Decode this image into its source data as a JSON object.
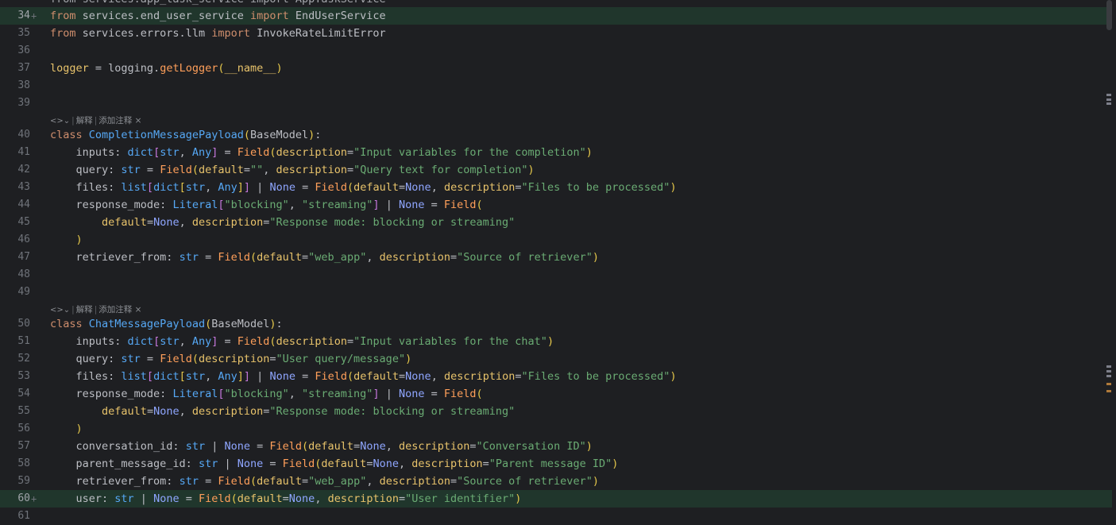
{
  "colors": {
    "background": "#1e1f22",
    "added_line": "#20362c",
    "keyword": "#cf8e6d",
    "string": "#6aab73",
    "function": "#56a8f5",
    "none": "#8fa6ff"
  },
  "top_partial": "from services.app_task_service import AppTaskService",
  "lens_labels": {
    "explain": "解释",
    "add_comment": "添加注释",
    "close": "×",
    "icon": "<>⌄"
  },
  "lines": [
    {
      "n": "34",
      "added": true,
      "tokens": [
        [
          "kw",
          "from"
        ],
        [
          "p",
          " services.end_user_service "
        ],
        [
          "kw",
          "import"
        ],
        [
          "p",
          " EndUserService"
        ]
      ]
    },
    {
      "n": "35",
      "tokens": [
        [
          "kw",
          "from"
        ],
        [
          "p",
          " services.errors.llm "
        ],
        [
          "kw",
          "import"
        ],
        [
          "p",
          " InvokeRateLimitError"
        ]
      ]
    },
    {
      "n": "36",
      "tokens": []
    },
    {
      "n": "37",
      "tokens": [
        [
          "field",
          "logger"
        ],
        [
          "p",
          " = logging."
        ],
        [
          "call",
          "getLogger"
        ],
        [
          "paren",
          "("
        ],
        [
          "field",
          "__name__"
        ],
        [
          "paren",
          ")"
        ]
      ]
    },
    {
      "n": "38",
      "tokens": []
    },
    {
      "n": "39",
      "tokens": []
    },
    {
      "lens": true
    },
    {
      "n": "40",
      "tokens": [
        [
          "kw",
          "class"
        ],
        [
          "p",
          " "
        ],
        [
          "cls",
          "CompletionMessagePayload"
        ],
        [
          "paren",
          "("
        ],
        [
          "p",
          "BaseModel"
        ],
        [
          "paren",
          ")"
        ],
        [
          "p",
          ":"
        ]
      ]
    },
    {
      "n": "41",
      "tokens": [
        [
          "p",
          "    inputs: "
        ],
        [
          "type",
          "dict"
        ],
        [
          "brk",
          "["
        ],
        [
          "type",
          "str"
        ],
        [
          "p",
          ", "
        ],
        [
          "type",
          "Any"
        ],
        [
          "brk",
          "]"
        ],
        [
          "p",
          " = "
        ],
        [
          "call",
          "Field"
        ],
        [
          "paren",
          "("
        ],
        [
          "kwarg",
          "description"
        ],
        [
          "p",
          "="
        ],
        [
          "str",
          "\"Input variables for the completion\""
        ],
        [
          "paren",
          ")"
        ]
      ]
    },
    {
      "n": "42",
      "tokens": [
        [
          "p",
          "    query: "
        ],
        [
          "type",
          "str"
        ],
        [
          "p",
          " = "
        ],
        [
          "call",
          "Field"
        ],
        [
          "paren",
          "("
        ],
        [
          "kwarg",
          "default"
        ],
        [
          "p",
          "="
        ],
        [
          "str",
          "\"\""
        ],
        [
          "p",
          ", "
        ],
        [
          "kwarg",
          "description"
        ],
        [
          "p",
          "="
        ],
        [
          "str",
          "\"Query text for completion\""
        ],
        [
          "paren",
          ")"
        ]
      ]
    },
    {
      "n": "43",
      "tokens": [
        [
          "p",
          "    files: "
        ],
        [
          "type",
          "list"
        ],
        [
          "brk",
          "["
        ],
        [
          "type",
          "dict"
        ],
        [
          "paren",
          "["
        ],
        [
          "type",
          "str"
        ],
        [
          "p",
          ", "
        ],
        [
          "type",
          "Any"
        ],
        [
          "paren",
          "]"
        ],
        [
          "brk",
          "]"
        ],
        [
          "p",
          " | "
        ],
        [
          "none",
          "None"
        ],
        [
          "p",
          " = "
        ],
        [
          "call",
          "Field"
        ],
        [
          "paren",
          "("
        ],
        [
          "kwarg",
          "default"
        ],
        [
          "p",
          "="
        ],
        [
          "none",
          "None"
        ],
        [
          "p",
          ", "
        ],
        [
          "kwarg",
          "description"
        ],
        [
          "p",
          "="
        ],
        [
          "str",
          "\"Files to be processed\""
        ],
        [
          "paren",
          ")"
        ]
      ]
    },
    {
      "n": "44",
      "tokens": [
        [
          "p",
          "    response_mode: "
        ],
        [
          "type",
          "Literal"
        ],
        [
          "brk",
          "["
        ],
        [
          "str",
          "\"blocking\""
        ],
        [
          "p",
          ", "
        ],
        [
          "str",
          "\"streaming\""
        ],
        [
          "brk",
          "]"
        ],
        [
          "p",
          " | "
        ],
        [
          "none",
          "None"
        ],
        [
          "p",
          " = "
        ],
        [
          "call",
          "Field"
        ],
        [
          "paren",
          "("
        ]
      ]
    },
    {
      "n": "45",
      "tokens": [
        [
          "p",
          "        "
        ],
        [
          "kwarg",
          "default"
        ],
        [
          "p",
          "="
        ],
        [
          "none",
          "None"
        ],
        [
          "p",
          ", "
        ],
        [
          "kwarg",
          "description"
        ],
        [
          "p",
          "="
        ],
        [
          "str",
          "\"Response mode: blocking or streaming\""
        ]
      ]
    },
    {
      "n": "46",
      "tokens": [
        [
          "p",
          "    "
        ],
        [
          "paren",
          ")"
        ]
      ]
    },
    {
      "n": "47",
      "tokens": [
        [
          "p",
          "    retriever_from: "
        ],
        [
          "type",
          "str"
        ],
        [
          "p",
          " = "
        ],
        [
          "call",
          "Field"
        ],
        [
          "paren",
          "("
        ],
        [
          "kwarg",
          "default"
        ],
        [
          "p",
          "="
        ],
        [
          "str",
          "\"web_app\""
        ],
        [
          "p",
          ", "
        ],
        [
          "kwarg",
          "description"
        ],
        [
          "p",
          "="
        ],
        [
          "str",
          "\"Source of retriever\""
        ],
        [
          "paren",
          ")"
        ]
      ]
    },
    {
      "n": "48",
      "tokens": []
    },
    {
      "n": "49",
      "tokens": []
    },
    {
      "lens": true
    },
    {
      "n": "50",
      "tokens": [
        [
          "kw",
          "class"
        ],
        [
          "p",
          " "
        ],
        [
          "cls",
          "ChatMessagePayload"
        ],
        [
          "paren",
          "("
        ],
        [
          "p",
          "BaseModel"
        ],
        [
          "paren",
          ")"
        ],
        [
          "p",
          ":"
        ]
      ]
    },
    {
      "n": "51",
      "tokens": [
        [
          "p",
          "    inputs: "
        ],
        [
          "type",
          "dict"
        ],
        [
          "brk",
          "["
        ],
        [
          "type",
          "str"
        ],
        [
          "p",
          ", "
        ],
        [
          "type",
          "Any"
        ],
        [
          "brk",
          "]"
        ],
        [
          "p",
          " = "
        ],
        [
          "call",
          "Field"
        ],
        [
          "paren",
          "("
        ],
        [
          "kwarg",
          "description"
        ],
        [
          "p",
          "="
        ],
        [
          "str",
          "\"Input variables for the chat\""
        ],
        [
          "paren",
          ")"
        ]
      ]
    },
    {
      "n": "52",
      "tokens": [
        [
          "p",
          "    query: "
        ],
        [
          "type",
          "str"
        ],
        [
          "p",
          " = "
        ],
        [
          "call",
          "Field"
        ],
        [
          "paren",
          "("
        ],
        [
          "kwarg",
          "description"
        ],
        [
          "p",
          "="
        ],
        [
          "str",
          "\"User query/message\""
        ],
        [
          "paren",
          ")"
        ]
      ]
    },
    {
      "n": "53",
      "tokens": [
        [
          "p",
          "    files: "
        ],
        [
          "type",
          "list"
        ],
        [
          "brk",
          "["
        ],
        [
          "type",
          "dict"
        ],
        [
          "paren",
          "["
        ],
        [
          "type",
          "str"
        ],
        [
          "p",
          ", "
        ],
        [
          "type",
          "Any"
        ],
        [
          "paren",
          "]"
        ],
        [
          "brk",
          "]"
        ],
        [
          "p",
          " | "
        ],
        [
          "none",
          "None"
        ],
        [
          "p",
          " = "
        ],
        [
          "call",
          "Field"
        ],
        [
          "paren",
          "("
        ],
        [
          "kwarg",
          "default"
        ],
        [
          "p",
          "="
        ],
        [
          "none",
          "None"
        ],
        [
          "p",
          ", "
        ],
        [
          "kwarg",
          "description"
        ],
        [
          "p",
          "="
        ],
        [
          "str",
          "\"Files to be processed\""
        ],
        [
          "paren",
          ")"
        ]
      ]
    },
    {
      "n": "54",
      "tokens": [
        [
          "p",
          "    response_mode: "
        ],
        [
          "type",
          "Literal"
        ],
        [
          "brk",
          "["
        ],
        [
          "str",
          "\"blocking\""
        ],
        [
          "p",
          ", "
        ],
        [
          "str",
          "\"streaming\""
        ],
        [
          "brk",
          "]"
        ],
        [
          "p",
          " | "
        ],
        [
          "none",
          "None"
        ],
        [
          "p",
          " = "
        ],
        [
          "call",
          "Field"
        ],
        [
          "paren",
          "("
        ]
      ]
    },
    {
      "n": "55",
      "tokens": [
        [
          "p",
          "        "
        ],
        [
          "kwarg",
          "default"
        ],
        [
          "p",
          "="
        ],
        [
          "none",
          "None"
        ],
        [
          "p",
          ", "
        ],
        [
          "kwarg",
          "description"
        ],
        [
          "p",
          "="
        ],
        [
          "str",
          "\"Response mode: blocking or streaming\""
        ]
      ]
    },
    {
      "n": "56",
      "tokens": [
        [
          "p",
          "    "
        ],
        [
          "paren",
          ")"
        ]
      ]
    },
    {
      "n": "57",
      "tokens": [
        [
          "p",
          "    conversation_id: "
        ],
        [
          "type",
          "str"
        ],
        [
          "p",
          " | "
        ],
        [
          "none",
          "None"
        ],
        [
          "p",
          " = "
        ],
        [
          "call",
          "Field"
        ],
        [
          "paren",
          "("
        ],
        [
          "kwarg",
          "default"
        ],
        [
          "p",
          "="
        ],
        [
          "none",
          "None"
        ],
        [
          "p",
          ", "
        ],
        [
          "kwarg",
          "description"
        ],
        [
          "p",
          "="
        ],
        [
          "str",
          "\"Conversation ID\""
        ],
        [
          "paren",
          ")"
        ]
      ]
    },
    {
      "n": "58",
      "tokens": [
        [
          "p",
          "    parent_message_id: "
        ],
        [
          "type",
          "str"
        ],
        [
          "p",
          " | "
        ],
        [
          "none",
          "None"
        ],
        [
          "p",
          " = "
        ],
        [
          "call",
          "Field"
        ],
        [
          "paren",
          "("
        ],
        [
          "kwarg",
          "default"
        ],
        [
          "p",
          "="
        ],
        [
          "none",
          "None"
        ],
        [
          "p",
          ", "
        ],
        [
          "kwarg",
          "description"
        ],
        [
          "p",
          "="
        ],
        [
          "str",
          "\"Parent message ID\""
        ],
        [
          "paren",
          ")"
        ]
      ]
    },
    {
      "n": "59",
      "tokens": [
        [
          "p",
          "    retriever_from: "
        ],
        [
          "type",
          "str"
        ],
        [
          "p",
          " = "
        ],
        [
          "call",
          "Field"
        ],
        [
          "paren",
          "("
        ],
        [
          "kwarg",
          "default"
        ],
        [
          "p",
          "="
        ],
        [
          "str",
          "\"web_app\""
        ],
        [
          "p",
          ", "
        ],
        [
          "kwarg",
          "description"
        ],
        [
          "p",
          "="
        ],
        [
          "str",
          "\"Source of retriever\""
        ],
        [
          "paren",
          ")"
        ]
      ]
    },
    {
      "n": "60",
      "added": true,
      "tokens": [
        [
          "p",
          "    user: "
        ],
        [
          "type",
          "str"
        ],
        [
          "p",
          " | "
        ],
        [
          "none",
          "None"
        ],
        [
          "p",
          " = "
        ],
        [
          "call",
          "Field"
        ],
        [
          "paren",
          "("
        ],
        [
          "kwarg",
          "default"
        ],
        [
          "p",
          "="
        ],
        [
          "none",
          "None"
        ],
        [
          "p",
          ", "
        ],
        [
          "kwarg",
          "description"
        ],
        [
          "p",
          "="
        ],
        [
          "str",
          "\"User identifier\""
        ],
        [
          "paren",
          ")"
        ]
      ]
    },
    {
      "n": "61",
      "tokens": []
    }
  ]
}
